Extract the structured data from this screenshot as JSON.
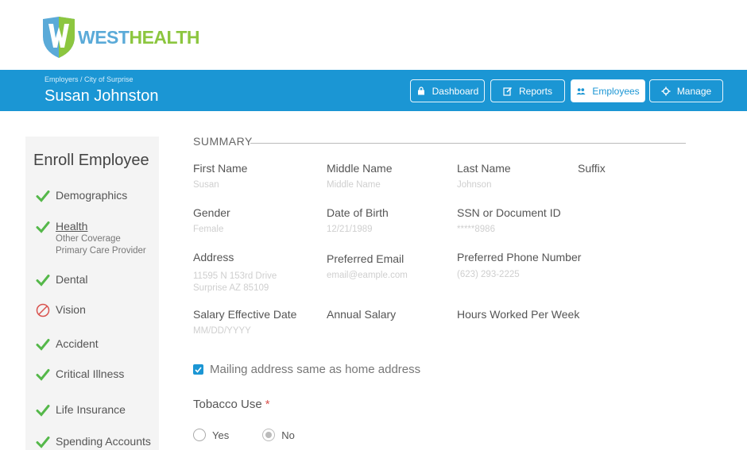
{
  "brand": {
    "part1": "WEST",
    "part2": "HEALTH",
    "accent": "#1b96d4",
    "logo_blue": "#5aaad8",
    "logo_green": "#8cc63f"
  },
  "header": {
    "breadcrumb": "Employers / City of Surprise",
    "person_name": "Susan Johnston"
  },
  "nav": [
    {
      "label": "Dashboard",
      "icon": "lock-icon",
      "active": false
    },
    {
      "label": "Reports",
      "icon": "edit-icon",
      "active": false
    },
    {
      "label": "Employees",
      "icon": "users-icon",
      "active": true
    },
    {
      "label": "Manage",
      "icon": "gear-icon",
      "active": false
    }
  ],
  "sidebar": {
    "title": "Enroll Employee",
    "items": [
      {
        "label": "Demographics",
        "status": "complete"
      },
      {
        "label": "Health",
        "status": "complete",
        "sub": [
          "Other Coverage",
          "Primary Care Provider"
        ]
      },
      {
        "label": "Dental",
        "status": "complete"
      },
      {
        "label": "Vision",
        "status": "declined"
      },
      {
        "label": "Accident",
        "status": "complete"
      },
      {
        "label": "Critical Illness",
        "status": "complete"
      },
      {
        "label": "Life Insurance",
        "status": "complete"
      },
      {
        "label": "Spending Accounts",
        "status": "complete"
      }
    ]
  },
  "summary": {
    "title": "SUMMARY",
    "fields": {
      "first_name": {
        "label": "First Name",
        "value": "Susan"
      },
      "middle_name": {
        "label": "Middle Name",
        "value": "Middle Name"
      },
      "last_name": {
        "label": "Last Name",
        "value": "Johnson"
      },
      "suffix": {
        "label": "Suffix",
        "value": ""
      },
      "gender": {
        "label": "Gender",
        "value": "Female"
      },
      "dob": {
        "label": "Date of Birth",
        "value": "12/21/1989"
      },
      "ssn": {
        "label": "SSN or Document ID",
        "value": "*****8986"
      },
      "address": {
        "label": "Address",
        "value_line1": "11595 N 153rd Drive",
        "value_line2": "Surprise  AZ  85109"
      },
      "email": {
        "label": "Preferred Email",
        "value": "email@eample.com"
      },
      "phone": {
        "label": "Preferred Phone Number",
        "value": "(623) 293-2225"
      },
      "salary_date": {
        "label": "Salary Effective Date",
        "value": "MM/DD/YYYY"
      },
      "salary": {
        "label": "Annual Salary",
        "value": ""
      },
      "hours": {
        "label": "Hours Worked Per Week",
        "value": ""
      }
    },
    "mailing_checkbox": {
      "label": "Mailing address same as home address",
      "checked": true
    },
    "tobacco": {
      "label": "Tobacco Use",
      "required_mark": "*",
      "options": [
        {
          "label": "Yes",
          "selected": false
        },
        {
          "label": "No",
          "selected": true
        }
      ]
    }
  }
}
